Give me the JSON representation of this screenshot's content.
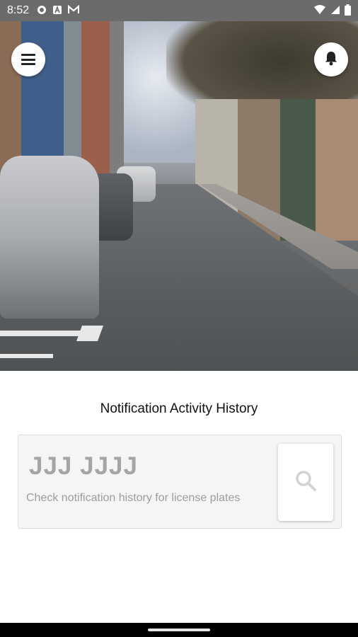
{
  "status_bar": {
    "time": "8:52",
    "icons": [
      "gear-icon",
      "a-app-icon",
      "gmail-icon"
    ],
    "right_icons": [
      "wifi-icon",
      "signal-icon",
      "battery-icon"
    ]
  },
  "hero": {
    "menu_icon": "menu-icon",
    "notifications_icon": "bell-icon"
  },
  "main": {
    "title": "Notification Activity History",
    "plate_value": "JJJ JJJJ",
    "hint": "Check notification history for license plates",
    "search_icon": "search-icon"
  },
  "colors": {
    "status_bar_bg": "#6b6b6b",
    "card_bg": "#f5f5f5",
    "muted_text": "#a5a5a5"
  }
}
